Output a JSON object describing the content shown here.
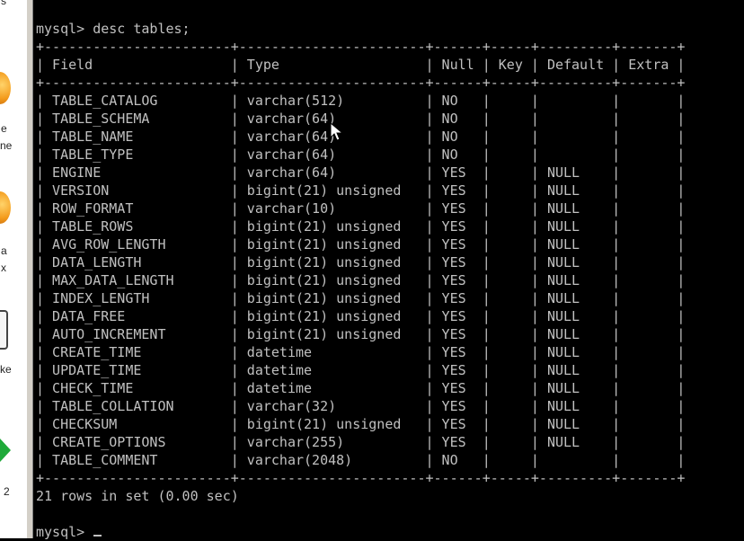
{
  "desktop": {
    "label_top": "s",
    "item1_labels": [
      "e",
      "ne"
    ],
    "item2_labels": [
      "a",
      "x"
    ],
    "item3_label": "ke",
    "item4_label": "2"
  },
  "console": {
    "command_line": "mysql> desc tables;",
    "separator": "+-----------------------+-----------------------+------+-----+---------+-------+",
    "headers": [
      "Field",
      "Type",
      "Null",
      "Key",
      "Default",
      "Extra"
    ],
    "rows": [
      [
        "TABLE_CATALOG",
        "varchar(512)",
        "NO",
        "",
        "",
        ""
      ],
      [
        "TABLE_SCHEMA",
        "varchar(64)",
        "NO",
        "",
        "",
        ""
      ],
      [
        "TABLE_NAME",
        "varchar(64)",
        "NO",
        "",
        "",
        ""
      ],
      [
        "TABLE_TYPE",
        "varchar(64)",
        "NO",
        "",
        "",
        ""
      ],
      [
        "ENGINE",
        "varchar(64)",
        "YES",
        "",
        "NULL",
        ""
      ],
      [
        "VERSION",
        "bigint(21) unsigned",
        "YES",
        "",
        "NULL",
        ""
      ],
      [
        "ROW_FORMAT",
        "varchar(10)",
        "YES",
        "",
        "NULL",
        ""
      ],
      [
        "TABLE_ROWS",
        "bigint(21) unsigned",
        "YES",
        "",
        "NULL",
        ""
      ],
      [
        "AVG_ROW_LENGTH",
        "bigint(21) unsigned",
        "YES",
        "",
        "NULL",
        ""
      ],
      [
        "DATA_LENGTH",
        "bigint(21) unsigned",
        "YES",
        "",
        "NULL",
        ""
      ],
      [
        "MAX_DATA_LENGTH",
        "bigint(21) unsigned",
        "YES",
        "",
        "NULL",
        ""
      ],
      [
        "INDEX_LENGTH",
        "bigint(21) unsigned",
        "YES",
        "",
        "NULL",
        ""
      ],
      [
        "DATA_FREE",
        "bigint(21) unsigned",
        "YES",
        "",
        "NULL",
        ""
      ],
      [
        "AUTO_INCREMENT",
        "bigint(21) unsigned",
        "YES",
        "",
        "NULL",
        ""
      ],
      [
        "CREATE_TIME",
        "datetime",
        "YES",
        "",
        "NULL",
        ""
      ],
      [
        "UPDATE_TIME",
        "datetime",
        "YES",
        "",
        "NULL",
        ""
      ],
      [
        "CHECK_TIME",
        "datetime",
        "YES",
        "",
        "NULL",
        ""
      ],
      [
        "TABLE_COLLATION",
        "varchar(32)",
        "YES",
        "",
        "NULL",
        ""
      ],
      [
        "CHECKSUM",
        "bigint(21) unsigned",
        "YES",
        "",
        "NULL",
        ""
      ],
      [
        "CREATE_OPTIONS",
        "varchar(255)",
        "YES",
        "",
        "NULL",
        ""
      ],
      [
        "TABLE_COMMENT",
        "varchar(2048)",
        "NO",
        "",
        "",
        ""
      ]
    ],
    "result_summary": "21 rows in set (0.00 sec)",
    "prompt": "mysql> ",
    "text_color": "#c0c0c0",
    "background_color": "#000000"
  }
}
